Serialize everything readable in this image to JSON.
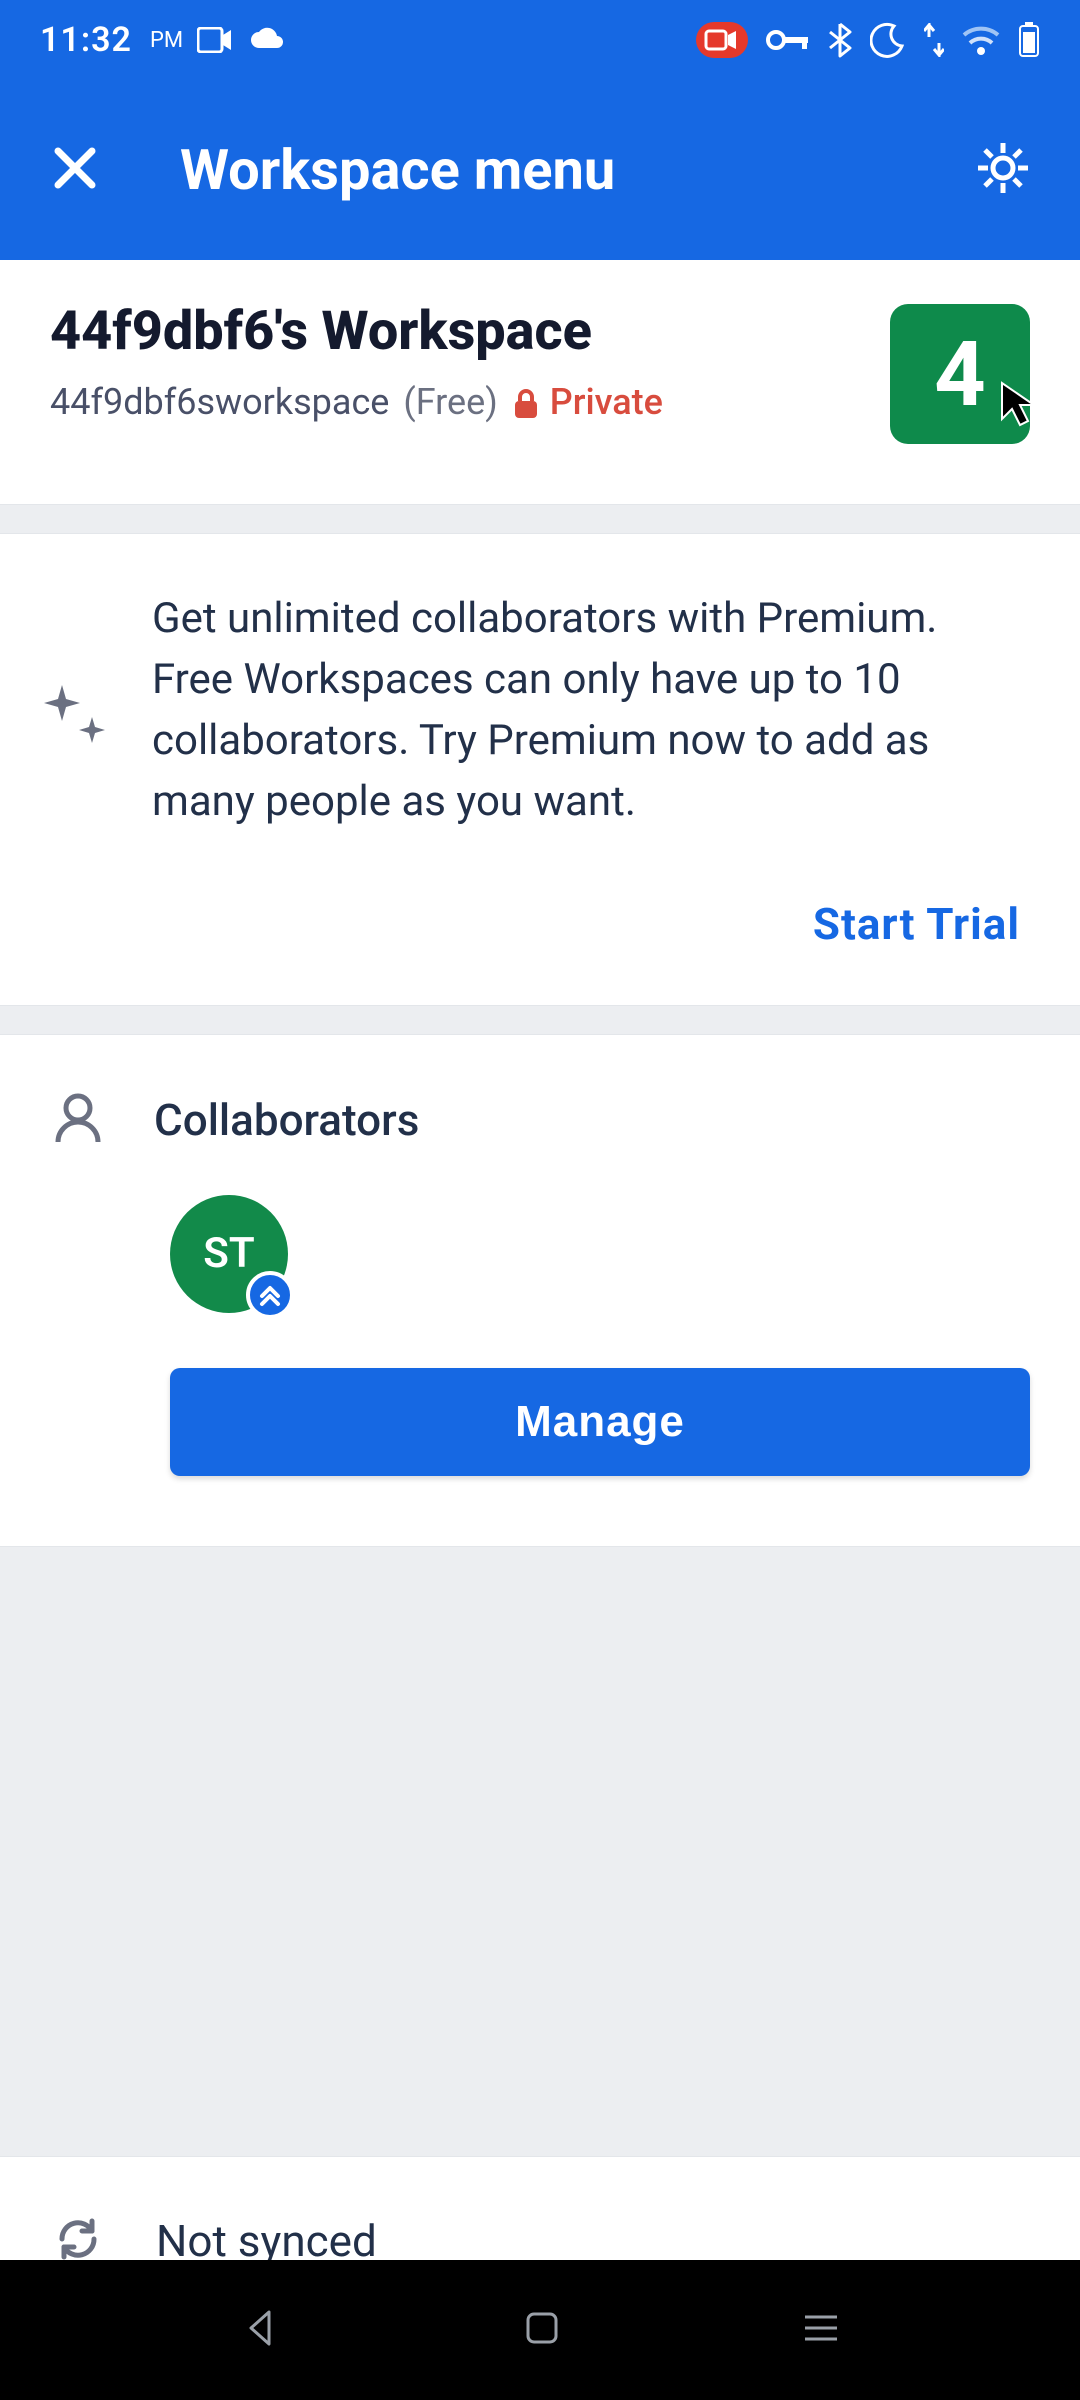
{
  "status": {
    "time": "11:32",
    "period": "PM"
  },
  "header": {
    "title": "Workspace menu"
  },
  "workspace": {
    "name": "44f9dbf6's Workspace",
    "slug": "44f9dbf6sworkspace",
    "plan": "(Free)",
    "privacy_label": "Private",
    "badge_digit": "4"
  },
  "promo": {
    "text": "Get unlimited collaborators with Premium. Free Workspaces can only have up to 10 collaborators. Try Premium now to add as many people as you want.",
    "cta": "Start Trial"
  },
  "collaborators": {
    "title": "Collaborators",
    "avatars": [
      {
        "initials": "ST"
      }
    ],
    "manage_label": "Manage"
  },
  "sync": {
    "status": "Not synced"
  }
}
